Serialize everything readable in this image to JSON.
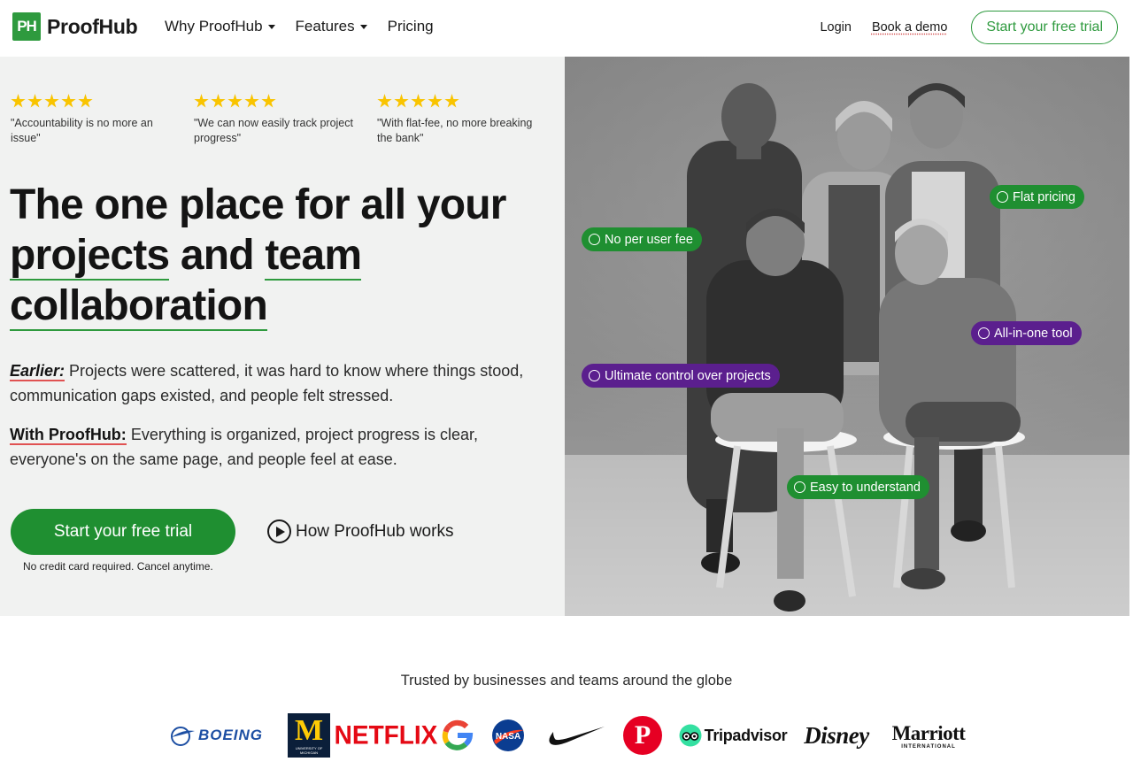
{
  "nav": {
    "logo_mark": "PH",
    "logo_text": "ProofHub",
    "menu": [
      {
        "label": "Why ProofHub",
        "dropdown": true
      },
      {
        "label": "Features",
        "dropdown": true
      },
      {
        "label": "Pricing",
        "dropdown": false
      }
    ],
    "login": "Login",
    "demo": "Book a demo",
    "cta": "Start your free trial"
  },
  "reviews": [
    {
      "stars": 5,
      "text": "\"Accountability is no more an issue\""
    },
    {
      "stars": 5,
      "text": "\"We can now easily track project progress\""
    },
    {
      "stars": 5,
      "text": "\"With flat-fee, no more breaking the bank\""
    }
  ],
  "hero": {
    "headline": {
      "part1": "The one place for all your ",
      "u1": "projects",
      "part2": " and ",
      "u2": "team",
      "u3": "collaboration"
    },
    "earlier_label": "Earlier:",
    "earlier_text": " Projects were scattered, it was hard to know where things stood, communication gaps existed, and people felt stressed.",
    "with_label": "With ProofHub:",
    "with_text": " Everything is organized, project progress is clear, everyone's on the same page, and people feel at ease.",
    "cta": "Start your free trial",
    "cta_note": "No credit card required. Cancel anytime.",
    "how": "How ProofHub works"
  },
  "pills": {
    "no_per_user": "No per user fee",
    "flat_pricing": "Flat pricing",
    "all_in_one": "All-in-one tool",
    "ultimate": "Ultimate control over projects",
    "easy": "Easy to understand"
  },
  "colors": {
    "brand_green": "#1f8f31",
    "pill_purple": "#5b1f8e",
    "star_yellow": "#f9c400",
    "hero_bg": "#f1f2f1"
  },
  "trusted": {
    "heading": "Trusted by businesses and teams around the globe",
    "logos": {
      "boeing": "BOEING",
      "michigan": "M",
      "michigan_sub": "UNIVERSITY OF MICHIGAN",
      "netflix": "NETFLIX",
      "google": "G",
      "nasa": "NASA",
      "nike": "nike-swoosh-icon",
      "pinterest": "P",
      "tripadvisor": "Tripadvisor",
      "disney": "Disney",
      "marriott": "Marriott",
      "marriott_sub": "INTERNATIONAL"
    }
  }
}
